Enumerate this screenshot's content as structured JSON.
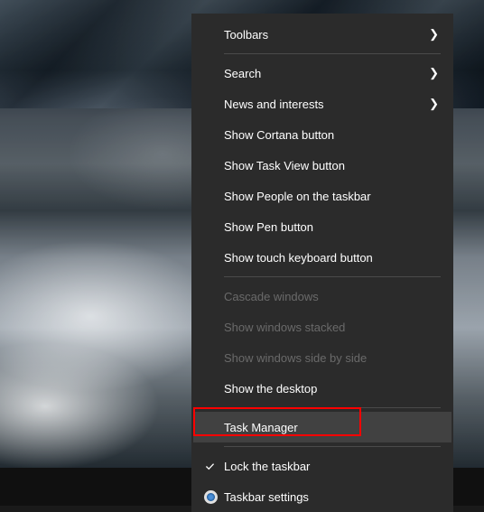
{
  "menu": {
    "groups": [
      {
        "items": [
          {
            "id": "toolbars",
            "label": "Toolbars",
            "submenu": true,
            "disabled": false,
            "icon": null
          }
        ]
      },
      {
        "items": [
          {
            "id": "search",
            "label": "Search",
            "submenu": true,
            "disabled": false,
            "icon": null
          },
          {
            "id": "news-interests",
            "label": "News and interests",
            "submenu": true,
            "disabled": false,
            "icon": null
          },
          {
            "id": "show-cortana",
            "label": "Show Cortana button",
            "submenu": false,
            "disabled": false,
            "icon": null
          },
          {
            "id": "show-task-view",
            "label": "Show Task View button",
            "submenu": false,
            "disabled": false,
            "icon": null
          },
          {
            "id": "show-people",
            "label": "Show People on the taskbar",
            "submenu": false,
            "disabled": false,
            "icon": null
          },
          {
            "id": "show-pen",
            "label": "Show Pen button",
            "submenu": false,
            "disabled": false,
            "icon": null
          },
          {
            "id": "show-touch-keyboard",
            "label": "Show touch keyboard button",
            "submenu": false,
            "disabled": false,
            "icon": null
          }
        ]
      },
      {
        "items": [
          {
            "id": "cascade-windows",
            "label": "Cascade windows",
            "submenu": false,
            "disabled": true,
            "icon": null
          },
          {
            "id": "show-stacked",
            "label": "Show windows stacked",
            "submenu": false,
            "disabled": true,
            "icon": null
          },
          {
            "id": "show-side-by-side",
            "label": "Show windows side by side",
            "submenu": false,
            "disabled": true,
            "icon": null
          },
          {
            "id": "show-desktop",
            "label": "Show the desktop",
            "submenu": false,
            "disabled": false,
            "icon": null
          }
        ]
      },
      {
        "items": [
          {
            "id": "task-manager",
            "label": "Task Manager",
            "submenu": false,
            "disabled": false,
            "icon": null,
            "hovered": true
          }
        ]
      },
      {
        "items": [
          {
            "id": "lock-taskbar",
            "label": "Lock the taskbar",
            "submenu": false,
            "disabled": false,
            "icon": "check"
          },
          {
            "id": "taskbar-settings",
            "label": "Taskbar settings",
            "submenu": false,
            "disabled": false,
            "icon": "gear"
          }
        ]
      }
    ]
  }
}
